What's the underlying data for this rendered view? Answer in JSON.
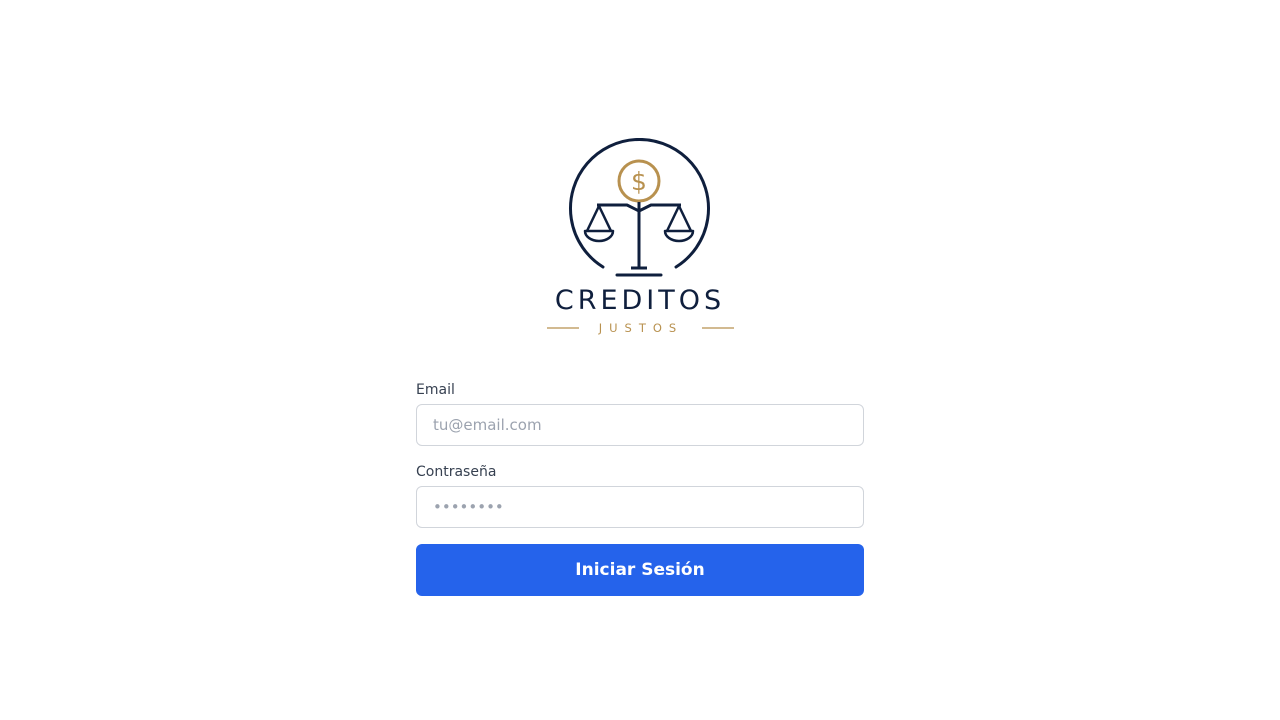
{
  "brand": {
    "name_line1": "CREDITOS",
    "name_line2": "JUSTOS",
    "coin_symbol": "$",
    "colors": {
      "navy": "#0f1f3d",
      "gold": "#b8914f"
    }
  },
  "form": {
    "email": {
      "label": "Email",
      "placeholder": "tu@email.com",
      "value": ""
    },
    "password": {
      "label": "Contraseña",
      "placeholder": "••••••••",
      "value": ""
    },
    "submit_label": "Iniciar Sesión",
    "submit_color": "#2563eb"
  }
}
